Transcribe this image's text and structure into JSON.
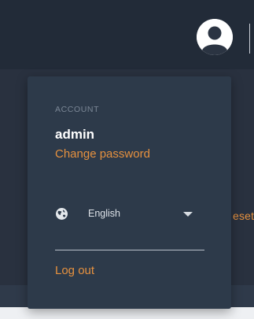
{
  "account_menu": {
    "section_label": "ACCOUNT",
    "username": "admin",
    "change_password_label": "Change password",
    "language": {
      "selected": "English"
    },
    "logout_label": "Log out"
  },
  "background": {
    "partial_text": "eset"
  },
  "icons": {
    "avatar": "user-avatar-icon",
    "language": "globe-icon",
    "dropdown": "caret-down-icon"
  },
  "colors": {
    "accent": "#e6913f",
    "panel": "#2d3a4a",
    "topbar": "#222b38",
    "text_primary": "#ffffff",
    "text_muted": "#7b8796"
  }
}
